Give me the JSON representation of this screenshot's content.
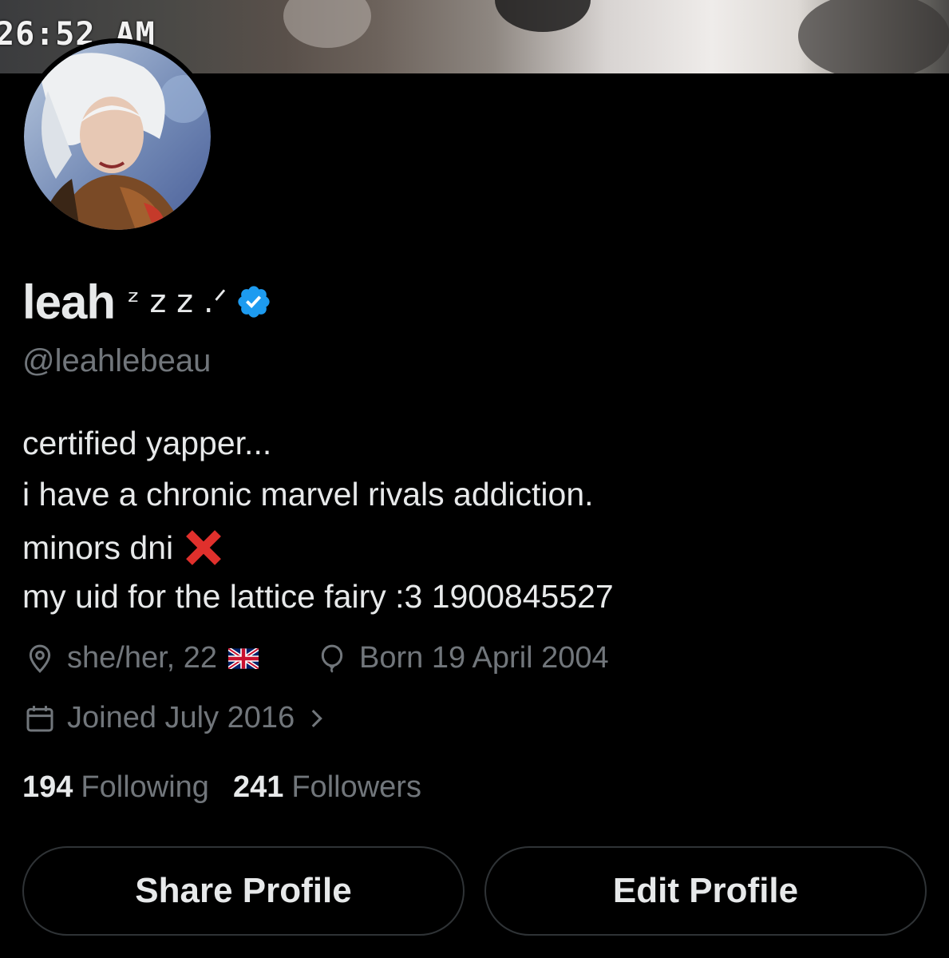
{
  "status_bar": {
    "time": "26:52 AM"
  },
  "profile": {
    "display_name": "leah",
    "name_decoration": "ᶻ z 𝗓 .ᐟ",
    "handle": "@leahlebeau",
    "bio": [
      "certified yapper...",
      "i have a chronic marvel rivals addiction.",
      "minors dni",
      "my uid for the lattice fairy :3 1900845527"
    ],
    "location": "she/her, 22",
    "birthday": "Born 19 April 2004",
    "joined": "Joined July 2016",
    "following_count": "194",
    "following_label": "Following",
    "followers_count": "241",
    "followers_label": "Followers"
  },
  "actions": {
    "share_label": "Share Profile",
    "edit_label": "Edit Profile"
  },
  "icons": {
    "verified": "verified-badge-icon",
    "location": "location-pin-icon",
    "birthday": "balloon-icon",
    "joined": "calendar-icon",
    "chevron": "chevron-right-icon",
    "cross": "red-cross-mark-icon",
    "flag": "uk-flag-icon"
  },
  "colors": {
    "background": "#000000",
    "text": "#e7e9ea",
    "secondary_text": "#71767b",
    "verified_blue": "#1d9bf0",
    "button_border": "#2f3336",
    "cross_red": "#e0302c"
  }
}
